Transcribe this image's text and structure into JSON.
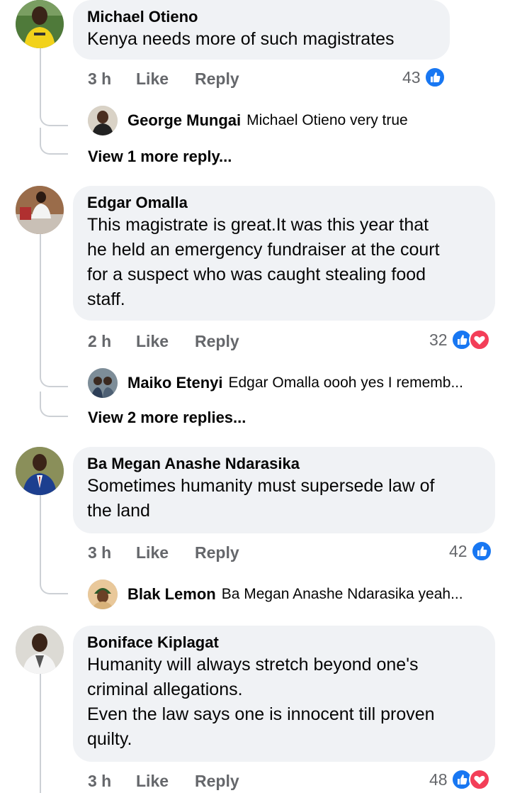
{
  "comments": [
    {
      "author": "Michael Otieno",
      "text": "Kenya needs more of such magistrates",
      "time": "3 h",
      "like": "Like",
      "reply": "Reply",
      "reaction_count": "43",
      "reactions": [
        "like"
      ],
      "reply_preview": {
        "author": "George Mungai",
        "text": "Michael Otieno very true"
      },
      "more_replies": "View 1 more reply..."
    },
    {
      "author": "Edgar Omalla",
      "text": "This magistrate is great.It was this year that\nhe held an emergency fundraiser at the court\nfor a suspect who was caught stealing food\nstaff.",
      "time": "2 h",
      "like": "Like",
      "reply": "Reply",
      "reaction_count": "32",
      "reactions": [
        "like",
        "love"
      ],
      "reply_preview": {
        "author": "Maiko Etenyi",
        "text": "Edgar Omalla oooh yes I rememb..."
      },
      "more_replies": "View 2 more replies..."
    },
    {
      "author": "Ba Megan Anashe Ndarasika",
      "text": "Sometimes humanity must supersede law of\nthe land",
      "time": "3 h",
      "like": "Like",
      "reply": "Reply",
      "reaction_count": "42",
      "reactions": [
        "like"
      ],
      "reply_preview": {
        "author": "Blak Lemon",
        "text": "Ba Megan Anashe Ndarasika yeah..."
      }
    },
    {
      "author": "Boniface Kiplagat",
      "text": "Humanity will always stretch beyond one's\ncriminal allegations.\nEven the law says one is innocent till proven\nquilty.",
      "time": "3 h",
      "like": "Like",
      "reply": "Reply",
      "reaction_count": "48",
      "reactions": [
        "like",
        "love"
      ]
    }
  ],
  "colors": {
    "bubble": "#f0f2f5",
    "meta": "#65676b",
    "like_blue": "#1877f2",
    "love_red": "#f33e58",
    "thread_line": "#ccd0d5"
  }
}
